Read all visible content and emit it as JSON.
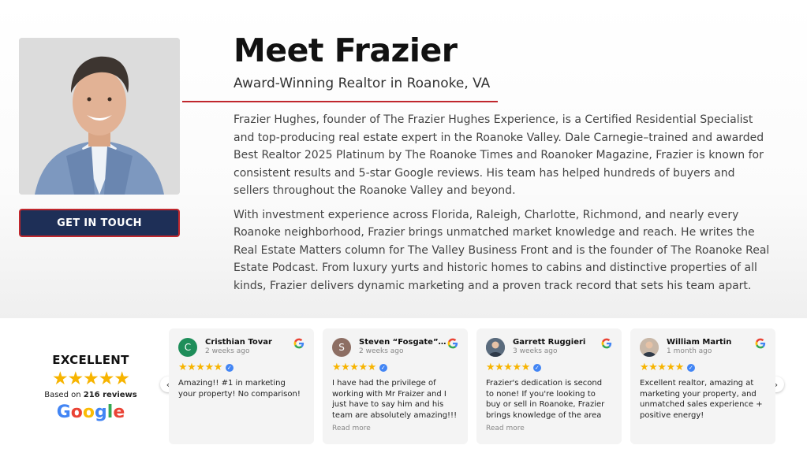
{
  "profile": {
    "title": "Meet Frazier",
    "subtitle": "Award-Winning Realtor in Roanoke, VA",
    "cta_label": "GET IN TOUCH",
    "bio": [
      "Frazier Hughes, founder of The Frazier Hughes Experience, is a Certified Residential Specialist and top-producing real estate expert in the Roanoke Valley. Dale Carnegie–trained and awarded Best Realtor 2025 Platinum by The Roanoke Times and Roanoker Magazine, Frazier is known for consistent results and 5-star Google reviews. His team has helped hundreds of buyers and sellers throughout the Roanoke Valley and beyond.",
      "With investment experience across Florida, Raleigh, Charlotte, Richmond, and nearly every Roanoke neighborhood, Frazier brings unmatched market knowledge and reach. He writes the Real Estate Matters column for The Valley Business Front and is the founder of The Roanoke Real Estate Podcast. From luxury yurts and historic homes to cabins and distinctive properties of all kinds, Frazier delivers dynamic marketing and a proven track record that sets his team apart."
    ]
  },
  "reviews_widget": {
    "rating_label": "EXCELLENT",
    "stars": "★★★★★",
    "rating": 5,
    "based_on_prefix": "Based on ",
    "review_count": "216 reviews",
    "brand": "Google",
    "prev_icon": "chevron-left-icon",
    "next_icon": "chevron-right-icon",
    "reviews": [
      {
        "name": "Cristhian Tovar",
        "when": "2 weeks ago",
        "avatar_letter": "C",
        "avatar_color": "#1e8e5a",
        "stars": "★★★★★",
        "text": "Amazing!! #1 in marketing your property! No comparison!",
        "read_more": ""
      },
      {
        "name": "Steven “Fosgate” Mc...",
        "when": "2 weeks ago",
        "avatar_letter": "S",
        "avatar_color": "#8d6e63",
        "stars": "★★★★★",
        "text": "I have had the privilege of working with Mr Fraizer and I just have to say him and his team are absolutely amazing!!! Great...",
        "read_more": "Read more"
      },
      {
        "name": "Garrett Ruggieri",
        "when": "3 weeks ago",
        "avatar_letter": "",
        "avatar_color": "#5a6b7d",
        "stars": "★★★★★",
        "text": "Frazier's dedication is second to none! If you're looking to buy or sell in Roanoke, Frazier brings knowledge of the area and a...",
        "read_more": "Read more"
      },
      {
        "name": "William Martin",
        "when": "1 month ago",
        "avatar_letter": "",
        "avatar_color": "#c9b8a8",
        "stars": "★★★★★",
        "text": "Excellent realtor, amazing at marketing your property, and unmatched sales experience + positive energy!",
        "read_more": ""
      }
    ]
  },
  "colors": {
    "navy": "#1e2f57",
    "accent_red": "#c0272d",
    "star_gold": "#f7b400",
    "google_blue": "#4285f4"
  }
}
